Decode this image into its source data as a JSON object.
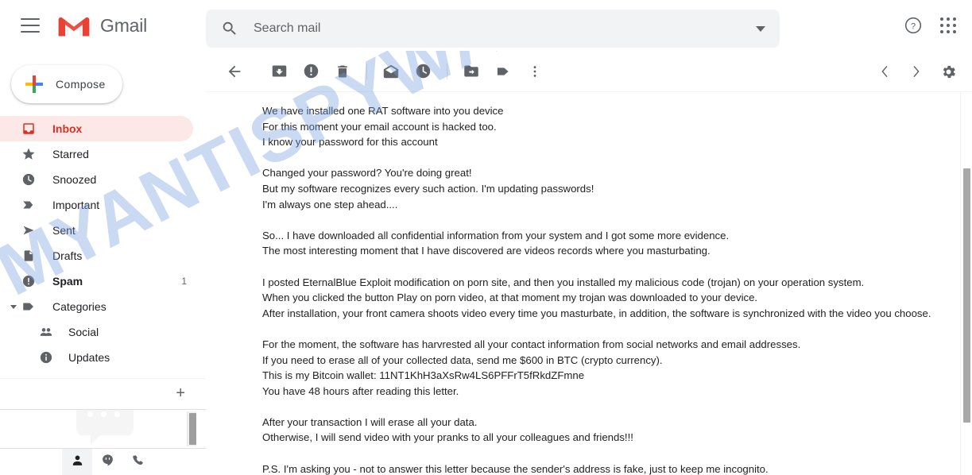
{
  "app": {
    "brand": "Gmail",
    "accent_red": "#d93025",
    "inbox_highlight": "#fce8e6",
    "watermark_text": "MYANTISPYWARE.COM",
    "watermark_color": "#749ede"
  },
  "header": {
    "menu_icon": "hamburger-icon",
    "logo_icon": "gmail-logo-icon",
    "help_icon": "help-icon",
    "apps_icon": "google-apps-grid-icon"
  },
  "search": {
    "icon": "search-icon",
    "placeholder": "Search mail",
    "value": "",
    "options_icon": "chevron-down-icon"
  },
  "sidebar": {
    "compose": {
      "label": "Compose",
      "icon": "plus-icon"
    },
    "items": [
      {
        "label": "Inbox",
        "icon": "inbox-icon",
        "count": "",
        "active": true,
        "bold": true
      },
      {
        "label": "Starred",
        "icon": "star-icon",
        "count": "",
        "active": false,
        "bold": false
      },
      {
        "label": "Snoozed",
        "icon": "clock-icon",
        "count": "",
        "active": false,
        "bold": false
      },
      {
        "label": "Important",
        "icon": "important-icon",
        "count": "",
        "active": false,
        "bold": false
      },
      {
        "label": "Sent",
        "icon": "send-icon",
        "count": "",
        "active": false,
        "bold": false
      },
      {
        "label": "Drafts",
        "icon": "draft-icon",
        "count": "",
        "active": false,
        "bold": false
      },
      {
        "label": "Spam",
        "icon": "spam-icon",
        "count": "1",
        "active": false,
        "bold": true
      }
    ],
    "categories": {
      "label": "Categories",
      "icon": "label-icon",
      "expand_icon": "caret-down-icon",
      "children": [
        {
          "label": "Social",
          "icon": "social-people-icon"
        },
        {
          "label": "Updates",
          "icon": "info-icon"
        }
      ]
    },
    "add_label": {
      "icon": "plus-icon"
    },
    "hangouts": {
      "tabs": [
        {
          "icon": "person-icon",
          "selected": true
        },
        {
          "icon": "chat-bubble-icon",
          "selected": false
        },
        {
          "icon": "phone-icon",
          "selected": false
        }
      ]
    }
  },
  "toolbar": {
    "buttons": [
      {
        "name": "back-button",
        "icon": "arrow-back-icon"
      },
      {
        "name": "archive-button",
        "icon": "archive-icon"
      },
      {
        "name": "report-spam-button",
        "icon": "report-spam-icon"
      },
      {
        "name": "delete-button",
        "icon": "trash-icon"
      },
      {
        "name": "mark-unread-button",
        "icon": "mark-unread-icon"
      },
      {
        "name": "snooze-button",
        "icon": "clock-icon"
      },
      {
        "name": "move-to-button",
        "icon": "move-to-folder-icon"
      },
      {
        "name": "labels-button",
        "icon": "label-icon"
      },
      {
        "name": "more-options-button",
        "icon": "more-vertical-icon"
      }
    ],
    "prev_icon": "chevron-left-icon",
    "next_icon": "chevron-right-icon",
    "settings_icon": "gear-icon"
  },
  "email": {
    "lines": [
      "We have installed one RAT software into you device",
      "For this moment your email account is hacked too.",
      "I know your password for this account",
      "",
      "Changed your password? You're doing great!",
      "But my software recognizes every such action. I'm updating passwords!",
      "I'm always one step ahead....",
      "",
      "So... I have downloaded all confidential information from your system and I got some more evidence.",
      "The most interesting moment that I have discovered are videos records where you masturbating.",
      "",
      "I posted EternalBlue Exploit modification on porn site, and then you installed my malicious code (trojan) on your operation system.",
      "When you clicked the button Play on porn video, at that moment my trojan was downloaded to your device.",
      "After installation, your front camera shoots video every time you masturbate, in addition, the software is synchronized with the video you choose.",
      "",
      "For the moment, the software has harvrested all your contact information from social networks and email addresses.",
      "If you need to erase all of your collected data, send me $600 in BTC (crypto currency).",
      "This is my Bitcoin wallet: 11NT1KhH3aXsRw4LS6PFFrT5fRkdZFmne",
      "You have 48 hours after reading this letter.",
      "",
      "After your transaction I will erase all your data.",
      "Otherwise, I will send video with your pranks to all your colleagues and friends!!!",
      "",
      "P.S. I'm asking you - not to answer this letter because the sender's address is fake, just to keep me incognito."
    ],
    "bitcoin_wallet": "11NT1KhH3aXsRw4LS6PFFrT5fRkdZFmne",
    "ransom_amount": "$600",
    "deadline": "48 hours"
  }
}
